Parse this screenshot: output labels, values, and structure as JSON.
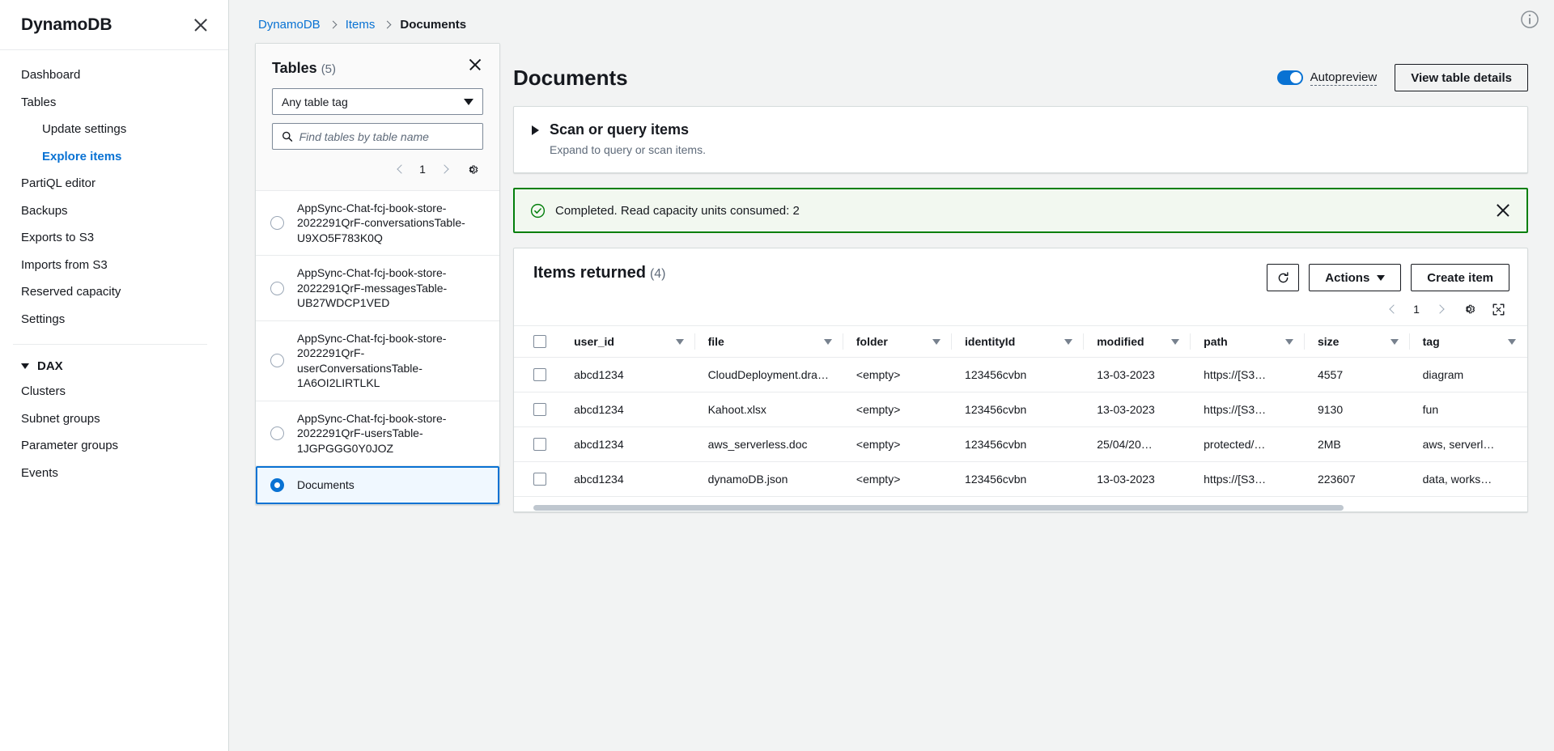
{
  "nav": {
    "title": "DynamoDB",
    "close_icon": "close-icon",
    "items": [
      {
        "label": "Dashboard",
        "level": "top",
        "active": false
      },
      {
        "label": "Tables",
        "level": "top",
        "active": false
      },
      {
        "label": "Update settings",
        "level": "sub",
        "active": false
      },
      {
        "label": "Explore items",
        "level": "sub",
        "active": true
      },
      {
        "label": "PartiQL editor",
        "level": "top",
        "active": false
      },
      {
        "label": "Backups",
        "level": "top",
        "active": false
      },
      {
        "label": "Exports to S3",
        "level": "top",
        "active": false
      },
      {
        "label": "Imports from S3",
        "level": "top",
        "active": false
      },
      {
        "label": "Reserved capacity",
        "level": "top",
        "active": false
      },
      {
        "label": "Settings",
        "level": "top",
        "active": false
      }
    ],
    "group": {
      "label": "DAX",
      "caret_icon": "caret-down-icon"
    },
    "group_items": [
      {
        "label": "Clusters"
      },
      {
        "label": "Subnet groups"
      },
      {
        "label": "Parameter groups"
      },
      {
        "label": "Events"
      }
    ]
  },
  "breadcrumb": {
    "items": [
      {
        "label": "DynamoDB",
        "current": false
      },
      {
        "label": "Items",
        "current": false
      },
      {
        "label": "Documents",
        "current": true
      }
    ]
  },
  "tables_panel": {
    "title": "Tables",
    "count": "(5)",
    "close_icon": "close-icon",
    "tag_filter": {
      "value": "Any table tag",
      "caret_icon": "chevron-down-icon"
    },
    "search": {
      "placeholder": "Find tables by table name",
      "value": "",
      "icon": "search-icon"
    },
    "pagination": {
      "prev_icon": "chevron-left-icon",
      "page": "1",
      "next_icon": "chevron-right-icon",
      "settings_icon": "gear-icon"
    },
    "rows": [
      {
        "name": "AppSync-Chat-fcj-book-store-2022291QrF-conversationsTable-U9XO5F783K0Q",
        "selected": false
      },
      {
        "name": "AppSync-Chat-fcj-book-store-2022291QrF-messagesTable-UB27WDCP1VED",
        "selected": false
      },
      {
        "name": "AppSync-Chat-fcj-book-store-2022291QrF-userConversationsTable-1A6OI2LIRTLKL",
        "selected": false
      },
      {
        "name": "AppSync-Chat-fcj-book-store-2022291QrF-usersTable-1JGPGGG0Y0JOZ",
        "selected": false
      },
      {
        "name": "Documents",
        "selected": true
      }
    ]
  },
  "documents": {
    "title": "Documents",
    "autopreview": {
      "label": "Autopreview",
      "enabled": true
    },
    "view_table_details_label": "View table details",
    "scan": {
      "title": "Scan or query items",
      "subtitle": "Expand to query or scan items.",
      "expand_icon": "triangle-right-icon"
    },
    "alert": {
      "text": "Completed. Read capacity units consumed: 2",
      "status_icon": "check-circle-icon",
      "close_icon": "close-icon",
      "color": "#037f0c"
    },
    "items_returned": {
      "title": "Items returned",
      "count": "(4)",
      "refresh_icon": "refresh-icon",
      "actions_label": "Actions",
      "actions_caret_icon": "caret-down-icon",
      "create_item_label": "Create item",
      "pagination": {
        "prev_icon": "chevron-left-icon",
        "page": "1",
        "next_icon": "chevron-right-icon",
        "settings_icon": "gear-icon",
        "expand_icon": "fullscreen-icon"
      }
    },
    "table": {
      "columns": [
        "user_id",
        "file",
        "folder",
        "identityId",
        "modified",
        "path",
        "size",
        "tag"
      ],
      "rows": [
        {
          "user_id": "abcd1234",
          "file": "CloudDeployment.dra…",
          "folder": "<empty>",
          "identityId": "123456cvbn",
          "modified": "13-03-2023",
          "path": "https://[S3…",
          "size": "4557",
          "tag": "diagram"
        },
        {
          "user_id": "abcd1234",
          "file": "Kahoot.xlsx",
          "folder": "<empty>",
          "identityId": "123456cvbn",
          "modified": "13-03-2023",
          "path": "https://[S3…",
          "size": "9130",
          "tag": "fun"
        },
        {
          "user_id": "abcd1234",
          "file": "aws_serverless.doc",
          "folder": "<empty>",
          "identityId": "123456cvbn",
          "modified": "25/04/20…",
          "path": "protected/…",
          "size": "2MB",
          "tag": "aws, serverl…"
        },
        {
          "user_id": "abcd1234",
          "file": "dynamoDB.json",
          "folder": "<empty>",
          "identityId": "123456cvbn",
          "modified": "13-03-2023",
          "path": "https://[S3…",
          "size": "223607",
          "tag": "data, works…"
        }
      ]
    }
  },
  "info_icon": "info-icon",
  "colors": {
    "link": "#0972d3",
    "success": "#037f0c",
    "selected_bg": "#f0f8ff"
  }
}
